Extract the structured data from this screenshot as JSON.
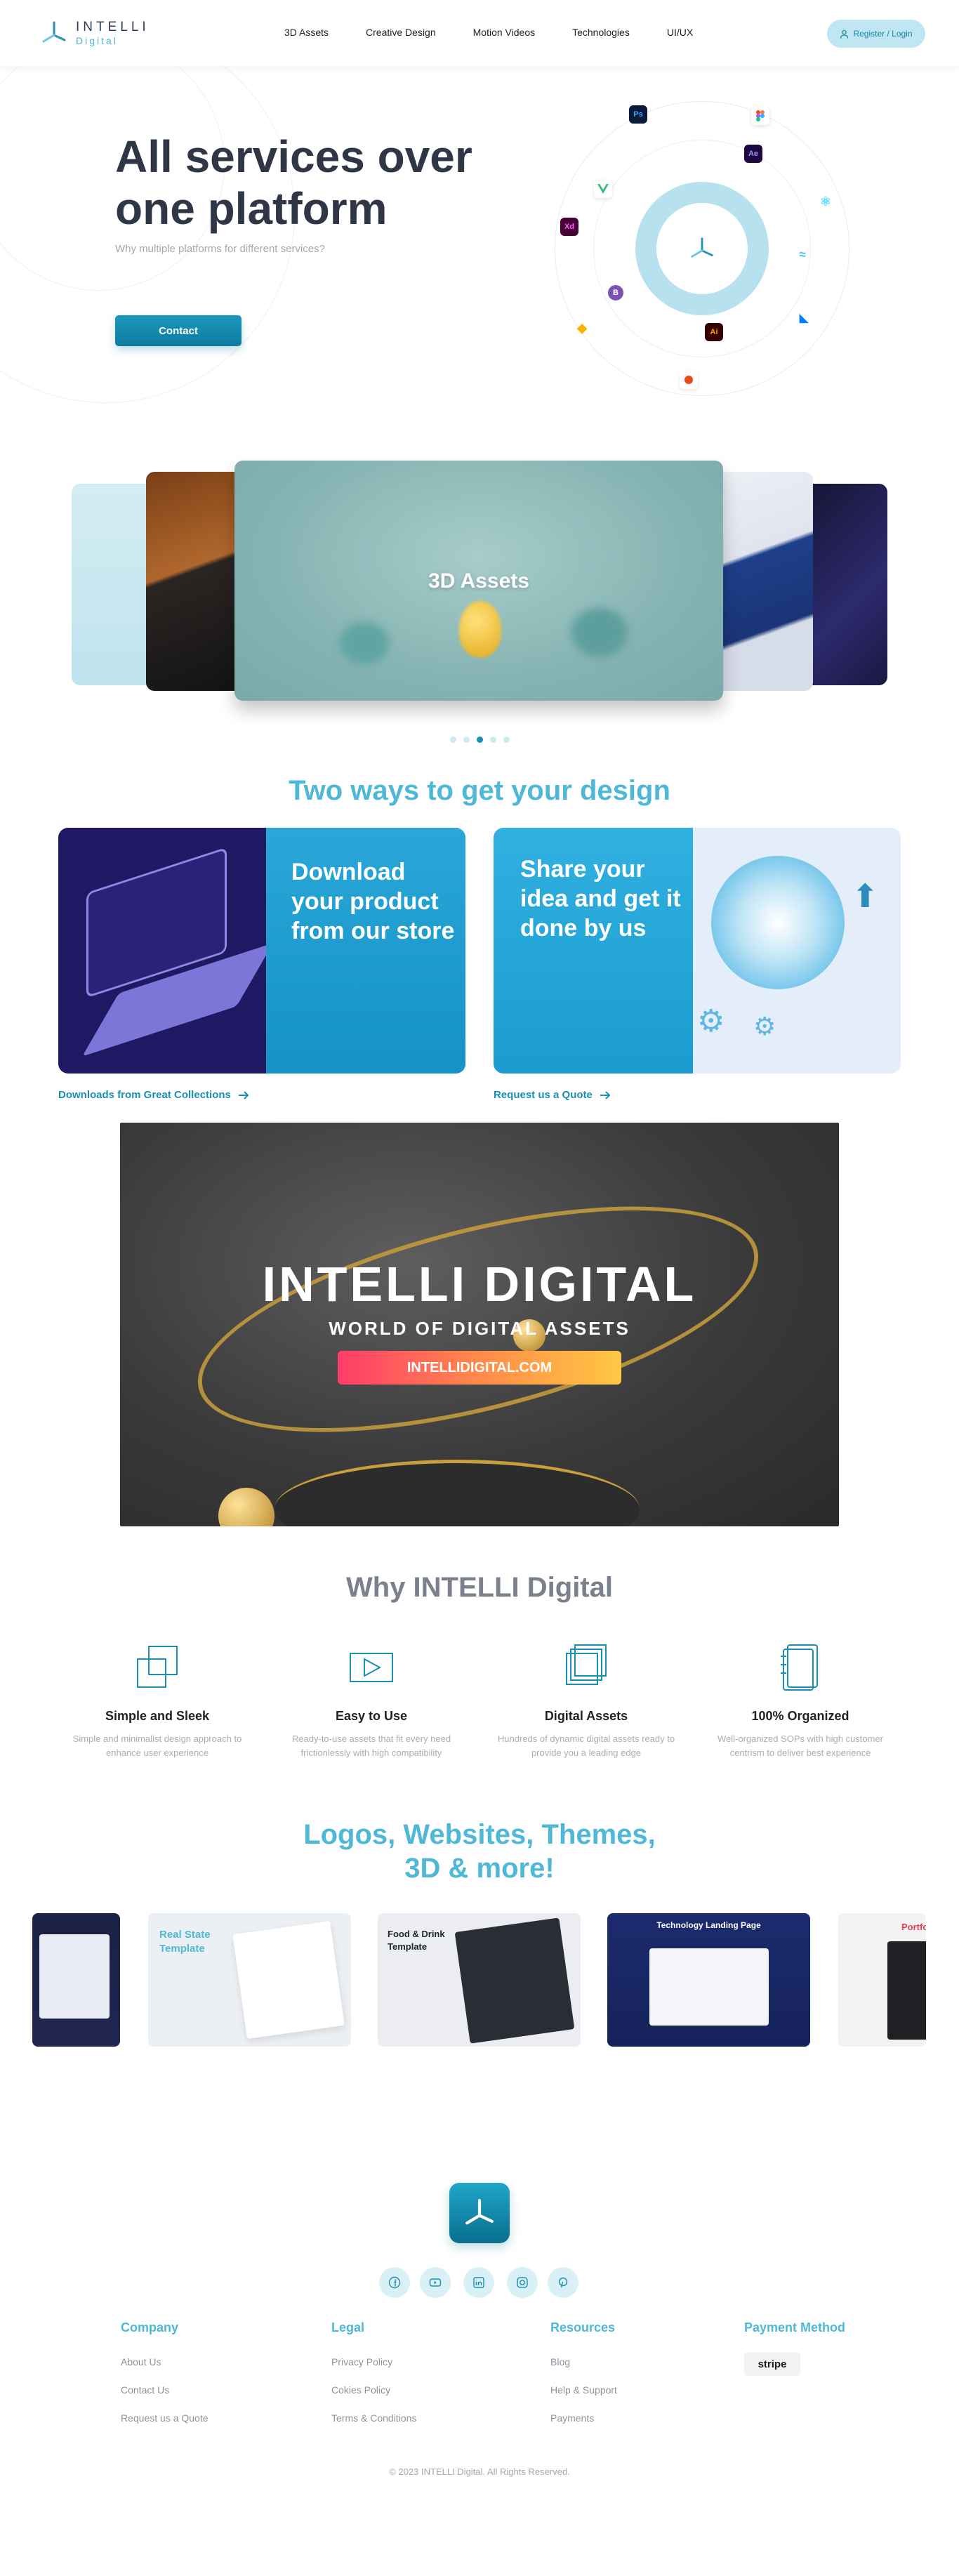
{
  "header": {
    "logo_name": "INTELLI",
    "logo_sub": "Digital",
    "nav": [
      "3D Assets",
      "Creative Design",
      "Motion Videos",
      "Technologies",
      "UI/UX"
    ],
    "register_label": "Register / Login"
  },
  "hero": {
    "title_line1": "All services over",
    "title_line2": "one platform",
    "subtitle": "Why multiple platforms for different services?",
    "contact_label": "Contact",
    "orbit_icons": [
      "Ps",
      "Ae",
      "Xd",
      "Ai"
    ]
  },
  "carousel": {
    "active_title": "3D Assets",
    "dot_count": 5,
    "active_dot": 3
  },
  "ways": {
    "title": "Two ways to get your design",
    "left_text": "Download your product from our store",
    "left_link": "Downloads from Great Collections",
    "right_text": "Share your idea and get it done by us",
    "right_link": "Request us a Quote"
  },
  "banner": {
    "big_text": "INTELLI DIGITAL",
    "tagline": "WORLD OF DIGITAL ASSETS",
    "url": "INTELLIDIGITAL.COM"
  },
  "why": {
    "title": "Why INTELLI Digital",
    "features": [
      {
        "title": "Simple and Sleek",
        "text": "Simple and minimalist design approach to enhance user experience"
      },
      {
        "title": "Easy to Use",
        "text": "Ready-to-use assets that fit every need frictionlessly with high compatibility"
      },
      {
        "title": "Digital Assets",
        "text": "Hundreds of dynamic digital assets ready to provide you a leading edge"
      },
      {
        "title": "100% Organized",
        "text": "Well-organized SOPs with high customer centrism to deliver best experience"
      }
    ]
  },
  "gallery": {
    "title_line1": "Logos, Websites, Themes,",
    "title_line2": "3D & more!",
    "tiles": [
      {
        "line1": "",
        "line2": ""
      },
      {
        "line1": "Real State",
        "line2": "Template"
      },
      {
        "line1": "Food & Drink",
        "line2": "Template"
      },
      {
        "line1": "Technology Landing Page",
        "line2": ""
      },
      {
        "line1": "Portfo",
        "line2": ""
      }
    ]
  },
  "footer": {
    "social": [
      "facebook-icon",
      "youtube-icon",
      "linkedin-icon",
      "instagram-icon",
      "pinterest-icon"
    ],
    "columns": [
      {
        "title": "Company",
        "links": [
          "About Us",
          "Contact Us",
          "Request us a Quote"
        ]
      },
      {
        "title": "Legal",
        "links": [
          "Privacy Policy",
          "Cokies Policy",
          "Terms & Conditions"
        ]
      },
      {
        "title": "Resources",
        "links": [
          "Blog",
          "Help & Support",
          "Payments"
        ]
      },
      {
        "title": "Payment Method",
        "links": []
      }
    ],
    "payment_badge": "stripe",
    "copyright": "© 2023 INTELLI Digital. All Rights Reserved."
  },
  "colors": {
    "accent": "#4fb8d6",
    "brand_dark": "#0e7c9e",
    "text_dark": "#2f3747"
  }
}
